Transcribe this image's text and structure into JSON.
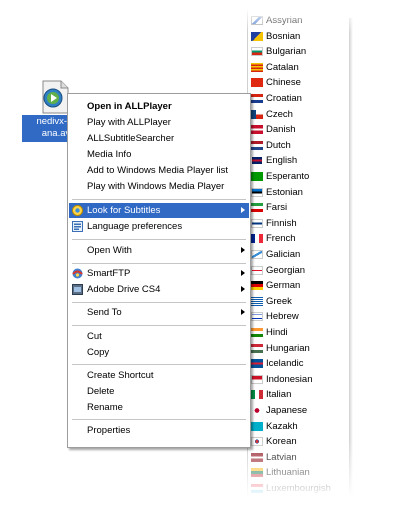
{
  "desktop_file": {
    "name_line1": "nedivx-hr",
    "name_line2": "ana.av",
    "icon": "media-file-icon"
  },
  "context_menu": {
    "items": [
      {
        "label": "Open in ALLPlayer",
        "bold": true
      },
      {
        "label": "Play with ALLPlayer"
      },
      {
        "label": "ALLSubtitleSearcher"
      },
      {
        "label": "Media Info"
      },
      {
        "label": "Add to Windows Media Player list"
      },
      {
        "label": "Play with Windows Media Player"
      },
      {
        "label": "Look for Subtitles",
        "highlighted": true,
        "submenu": true,
        "icon": "subtitle-search-icon"
      },
      {
        "label": "Language preferences",
        "icon": "language-prefs-icon"
      },
      {
        "label": "Open With",
        "submenu": true
      },
      {
        "label": "SmartFTP",
        "submenu": true,
        "icon": "smartftp-icon"
      },
      {
        "label": "Adobe Drive CS4",
        "submenu": true,
        "icon": "adobe-drive-icon"
      },
      {
        "label": "Send To",
        "submenu": true
      },
      {
        "label": "Cut"
      },
      {
        "label": "Copy"
      },
      {
        "label": "Create Shortcut"
      },
      {
        "label": "Delete"
      },
      {
        "label": "Rename"
      },
      {
        "label": "Properties"
      }
    ]
  },
  "languages_submenu": {
    "items": [
      {
        "label": "Assyrian",
        "flag": "assyrian-flag-icon"
      },
      {
        "label": "Bosnian",
        "flag": "bosnia-flag-icon"
      },
      {
        "label": "Bulgarian",
        "flag": "bulgaria-flag-icon"
      },
      {
        "label": "Catalan",
        "flag": "catalonia-flag-icon"
      },
      {
        "label": "Chinese",
        "flag": "china-flag-icon"
      },
      {
        "label": "Croatian",
        "flag": "croatia-flag-icon"
      },
      {
        "label": "Czech",
        "flag": "czech-flag-icon"
      },
      {
        "label": "Danish",
        "flag": "denmark-flag-icon"
      },
      {
        "label": "Dutch",
        "flag": "netherlands-flag-icon"
      },
      {
        "label": "English",
        "flag": "uk-flag-icon"
      },
      {
        "label": "Esperanto",
        "flag": "esperanto-flag-icon"
      },
      {
        "label": "Estonian",
        "flag": "estonia-flag-icon"
      },
      {
        "label": "Farsi",
        "flag": "iran-flag-icon"
      },
      {
        "label": "Finnish",
        "flag": "finland-flag-icon"
      },
      {
        "label": "French",
        "flag": "france-flag-icon"
      },
      {
        "label": "Galician",
        "flag": "galicia-flag-icon"
      },
      {
        "label": "Georgian",
        "flag": "georgia-flag-icon"
      },
      {
        "label": "German",
        "flag": "germany-flag-icon"
      },
      {
        "label": "Greek",
        "flag": "greece-flag-icon"
      },
      {
        "label": "Hebrew",
        "flag": "israel-flag-icon"
      },
      {
        "label": "Hindi",
        "flag": "india-flag-icon"
      },
      {
        "label": "Hungarian",
        "flag": "hungary-flag-icon"
      },
      {
        "label": "Icelandic",
        "flag": "iceland-flag-icon"
      },
      {
        "label": "Indonesian",
        "flag": "indonesia-flag-icon"
      },
      {
        "label": "Italian",
        "flag": "italy-flag-icon"
      },
      {
        "label": "Japanese",
        "flag": "japan-flag-icon"
      },
      {
        "label": "Kazakh",
        "flag": "kazakhstan-flag-icon"
      },
      {
        "label": "Korean",
        "flag": "korea-flag-icon"
      },
      {
        "label": "Latvian",
        "flag": "latvia-flag-icon"
      },
      {
        "label": "Lithuanian",
        "flag": "lithuania-flag-icon"
      },
      {
        "label": "Luxembourgish",
        "flag": "luxembourg-flag-icon"
      }
    ]
  },
  "colors": {
    "highlight": "#316ac5",
    "menu_border": "#9d9d9d",
    "separator": "#c5c5c5"
  }
}
